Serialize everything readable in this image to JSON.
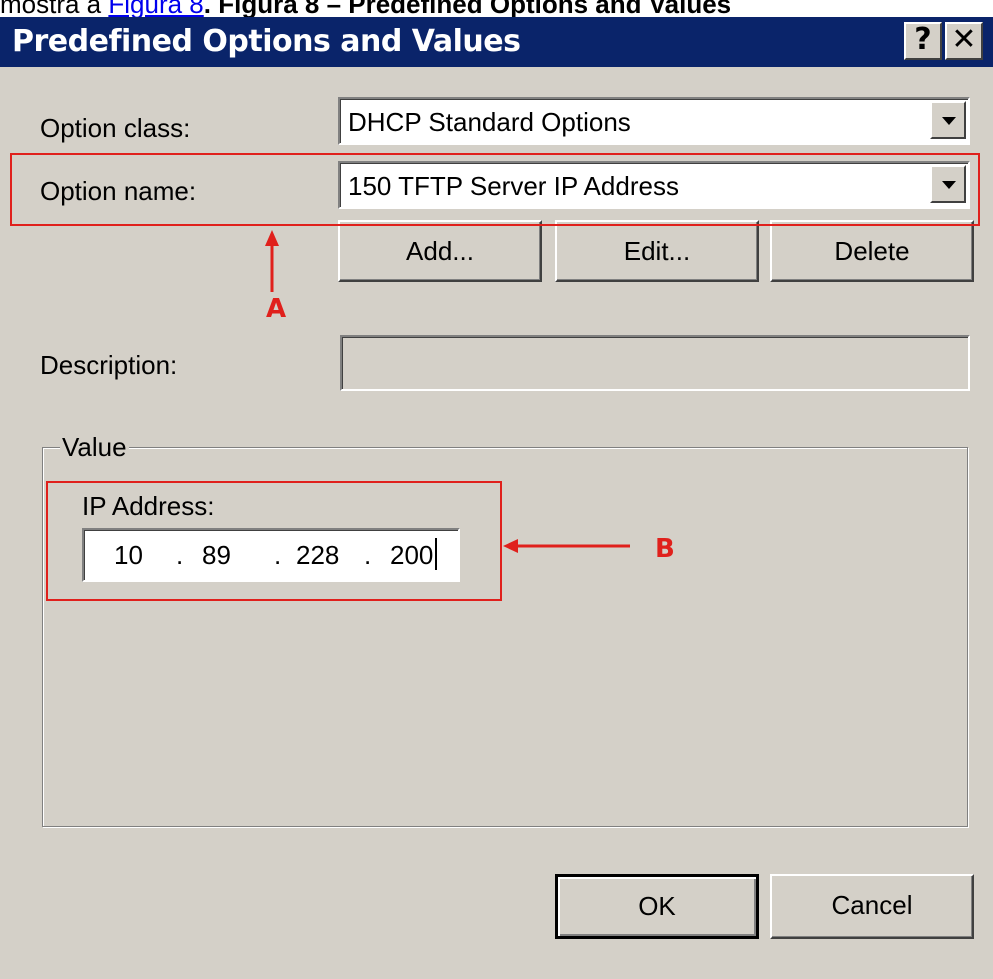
{
  "caption": {
    "prefix": "mostra a ",
    "link": "Figura 8",
    "suffix": ". Figura 8 – Predefined Options and Values"
  },
  "dialog": {
    "title": "Predefined Options and Values",
    "help_label": "?",
    "close_label": "✕",
    "option_class_label": "Option class:",
    "option_class_value": "DHCP Standard Options",
    "option_name_label": "Option name:",
    "option_name_value": "150 TFTP Server IP Address",
    "add_button": "Add...",
    "edit_button": "Edit...",
    "delete_button": "Delete",
    "description_label": "Description:",
    "description_value": "",
    "value_group_title": "Value",
    "ip_label": "IP Address:",
    "ip": [
      "10",
      "89",
      "228",
      "200"
    ],
    "ok_button": "OK",
    "cancel_button": "Cancel"
  },
  "annotations": {
    "a_label": "A",
    "b_label": "B",
    "color": "#e0201c"
  },
  "colors": {
    "titlebar": "#0a246a",
    "dialog_bg": "#d4d0c8"
  }
}
